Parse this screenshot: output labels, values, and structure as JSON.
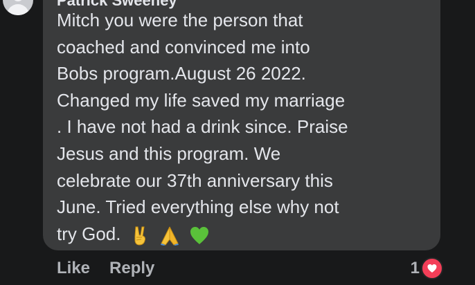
{
  "comment": {
    "author": "Patrick Sweeney",
    "text_lines": [
      "Mitch you were the person that",
      "coached and convinced me into",
      "Bobs program.August 26 2022.",
      "Changed my life saved my marriage",
      ". I have not had a drink since. Praise",
      "Jesus and this program. We",
      "celebrate our 37th anniversary this",
      "June. Tried everything else why not",
      "try God."
    ],
    "emojis": [
      "victory-hand",
      "folded-hands",
      "green-heart"
    ]
  },
  "actions": {
    "like_label": "Like",
    "reply_label": "Reply"
  },
  "reactions": {
    "count": "1",
    "type": "heart"
  },
  "colors": {
    "background": "#18191a",
    "bubble": "#3a3b3c",
    "text": "#e4e6eb",
    "secondary_text": "#b0b3b8",
    "heart": "#f33e58"
  }
}
